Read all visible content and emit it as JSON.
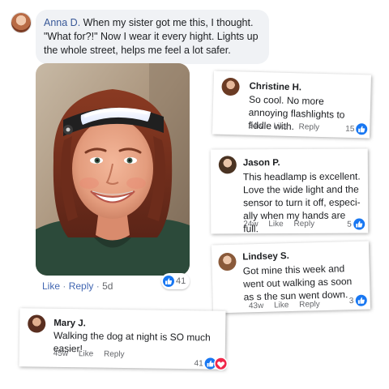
{
  "post": {
    "author": "Anna D.",
    "text": " When my sister got me this, I thought. \"What for?!\" Now I wear it every hight. Lights up the whole street, helps me feel a lot safer.",
    "like_label": "Like",
    "separator": "·",
    "reply_label": "Reply",
    "time": "5d",
    "reaction_count": "41",
    "photo_icon": "woman-wearing-headlamp-photo"
  },
  "comments": [
    {
      "name": "Christine H.",
      "text": "So cool. No more annoying flashlights to fiddle with.",
      "time": "24w",
      "like_label": "Like",
      "reply_label": "Reply",
      "reaction_count": "15",
      "reactions": [
        "like"
      ]
    },
    {
      "name": "Jason P.",
      "text": "This headlamp is excellent. Love the wide light and the sensor to turn it off, especi-ally when my hands are full.",
      "time": "24w",
      "like_label": "Like",
      "reply_label": "Reply",
      "reaction_count": "5",
      "reactions": [
        "like"
      ]
    },
    {
      "name": "Lindsey S.",
      "text": "Got mine this week and went out walking as soon as s the sun went down.",
      "time": "43w",
      "like_label": "Like",
      "reply_label": "Reply",
      "reaction_count": "3",
      "reactions": [
        "like"
      ]
    },
    {
      "name": "Mary J.",
      "text": "Walking the dog at night is SO much easier!",
      "time": "45w",
      "like_label": "Like",
      "reply_label": "Reply",
      "reaction_count": "41",
      "reactions": [
        "like",
        "love"
      ]
    }
  ],
  "colors": {
    "link_blue": "#385898",
    "action_blue": "#4267b2",
    "like_blue": "#1877f2",
    "love_red": "#f0284a",
    "bubble_gray": "#f0f2f5",
    "meta_gray": "#65676b"
  }
}
